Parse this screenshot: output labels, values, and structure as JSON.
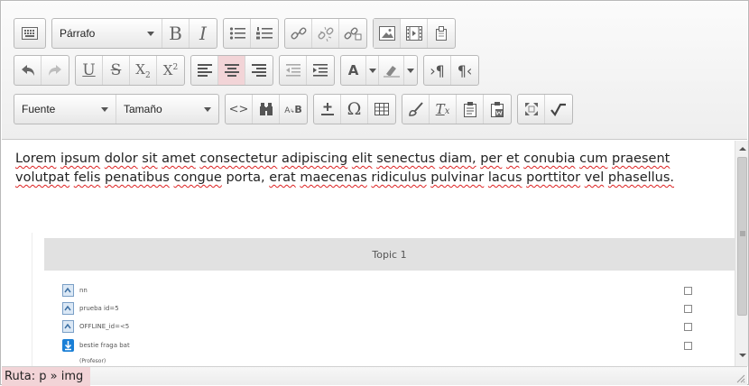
{
  "toolbar": {
    "paragraph_label": "Párrafo",
    "font_label": "Fuente",
    "size_label": "Tamaño",
    "bold": "B",
    "italic": "I",
    "underline": "U",
    "strike": "S",
    "subscript": "X",
    "subscript_mark": "2",
    "superscript": "X",
    "superscript_mark": "2",
    "omega": "Ω",
    "pilcrow_ltr": "¶",
    "pilcrow_rtl": "¶",
    "tx": "T",
    "tx_mark": "x",
    "search_a": "A",
    "search_b": "B",
    "font_color_a": "A",
    "code": "<>",
    "active_button": "align-center"
  },
  "content": {
    "words": [
      "Lorem",
      "ipsum",
      "dolor",
      "sit",
      "amet",
      "consectetur",
      "adipiscing",
      "elit",
      "senectus",
      "diam,",
      "per",
      "et",
      "conubia",
      "cum",
      "praesent",
      "volutpat",
      "felis",
      "penatibus",
      "congue",
      "porta,",
      "erat",
      "maecenas",
      "ridiculus",
      "pulvinar",
      "lacus",
      "porttitor",
      "vel",
      "phasellus."
    ],
    "topic_title": "Topic 1",
    "activities": [
      {
        "label": "nn"
      },
      {
        "label": "prueba id=5"
      },
      {
        "label": "OFFLINE_id=<5"
      },
      {
        "label": "bestie fraga bat"
      }
    ],
    "cut_label": "(Profesor)"
  },
  "status": {
    "path": "Ruta: p » img"
  },
  "colors": {
    "active_highlight": "#f2d4d7",
    "spell_underline": "#dd2222",
    "download_icon": "#1a7fd6"
  }
}
